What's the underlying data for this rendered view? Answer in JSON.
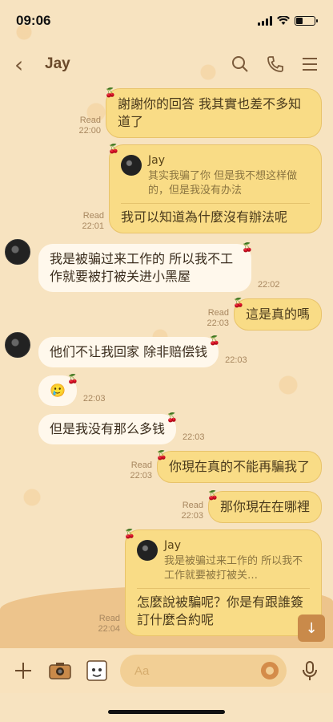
{
  "status": {
    "time": "09:06"
  },
  "header": {
    "back": "‹",
    "name": "Jay"
  },
  "messages": {
    "m1": {
      "meta_read": "Read",
      "meta_time": "22:00",
      "text": "謝謝你的回答 我其實也差不多知道了"
    },
    "m2": {
      "meta_read": "Read",
      "meta_time": "22:01",
      "reply_name": "Jay",
      "reply_text": "其实我骗了你 但是我不想这样做的，但是我没有办法",
      "text": "我可以知道為什麼沒有辦法呢"
    },
    "m3": {
      "text": "我是被骗过来工作的 所以我不工作就要被打被关进小黑屋",
      "time": "22:02"
    },
    "m4": {
      "meta_read": "Read",
      "meta_time": "22:03",
      "text": "這是真的嗎"
    },
    "m5": {
      "text": "他们不让我回家 除非赔偿钱",
      "time": "22:03"
    },
    "m6": {
      "text": "🥲",
      "time": "22:03"
    },
    "m7": {
      "text": "但是我没有那么多钱",
      "time": "22:03"
    },
    "m8": {
      "meta_read": "Read",
      "meta_time": "22:03",
      "text": "你現在真的不能再騙我了"
    },
    "m9": {
      "meta_read": "Read",
      "meta_time": "22:03",
      "text": "那你現在在哪裡"
    },
    "m10": {
      "meta_read": "Read",
      "meta_time": "22:04",
      "reply_name": "Jay",
      "reply_text": "我是被骗过来工作的 所以我不工作就要被打被关…",
      "text": "怎麼說被騙呢？你是有跟誰簽訂什麼合約呢"
    }
  },
  "input": {
    "placeholder": "Aa"
  },
  "colors": {
    "out_bubble": "#f9dc86",
    "in_bubble": "#fff8ec",
    "accent": "#c98a4a"
  },
  "icons": [
    "back-icon",
    "search-icon",
    "phone-icon",
    "menu-icon",
    "plus-icon",
    "camera-icon",
    "sticker-icon",
    "emoji-icon",
    "mic-icon",
    "scroll-down-icon"
  ]
}
